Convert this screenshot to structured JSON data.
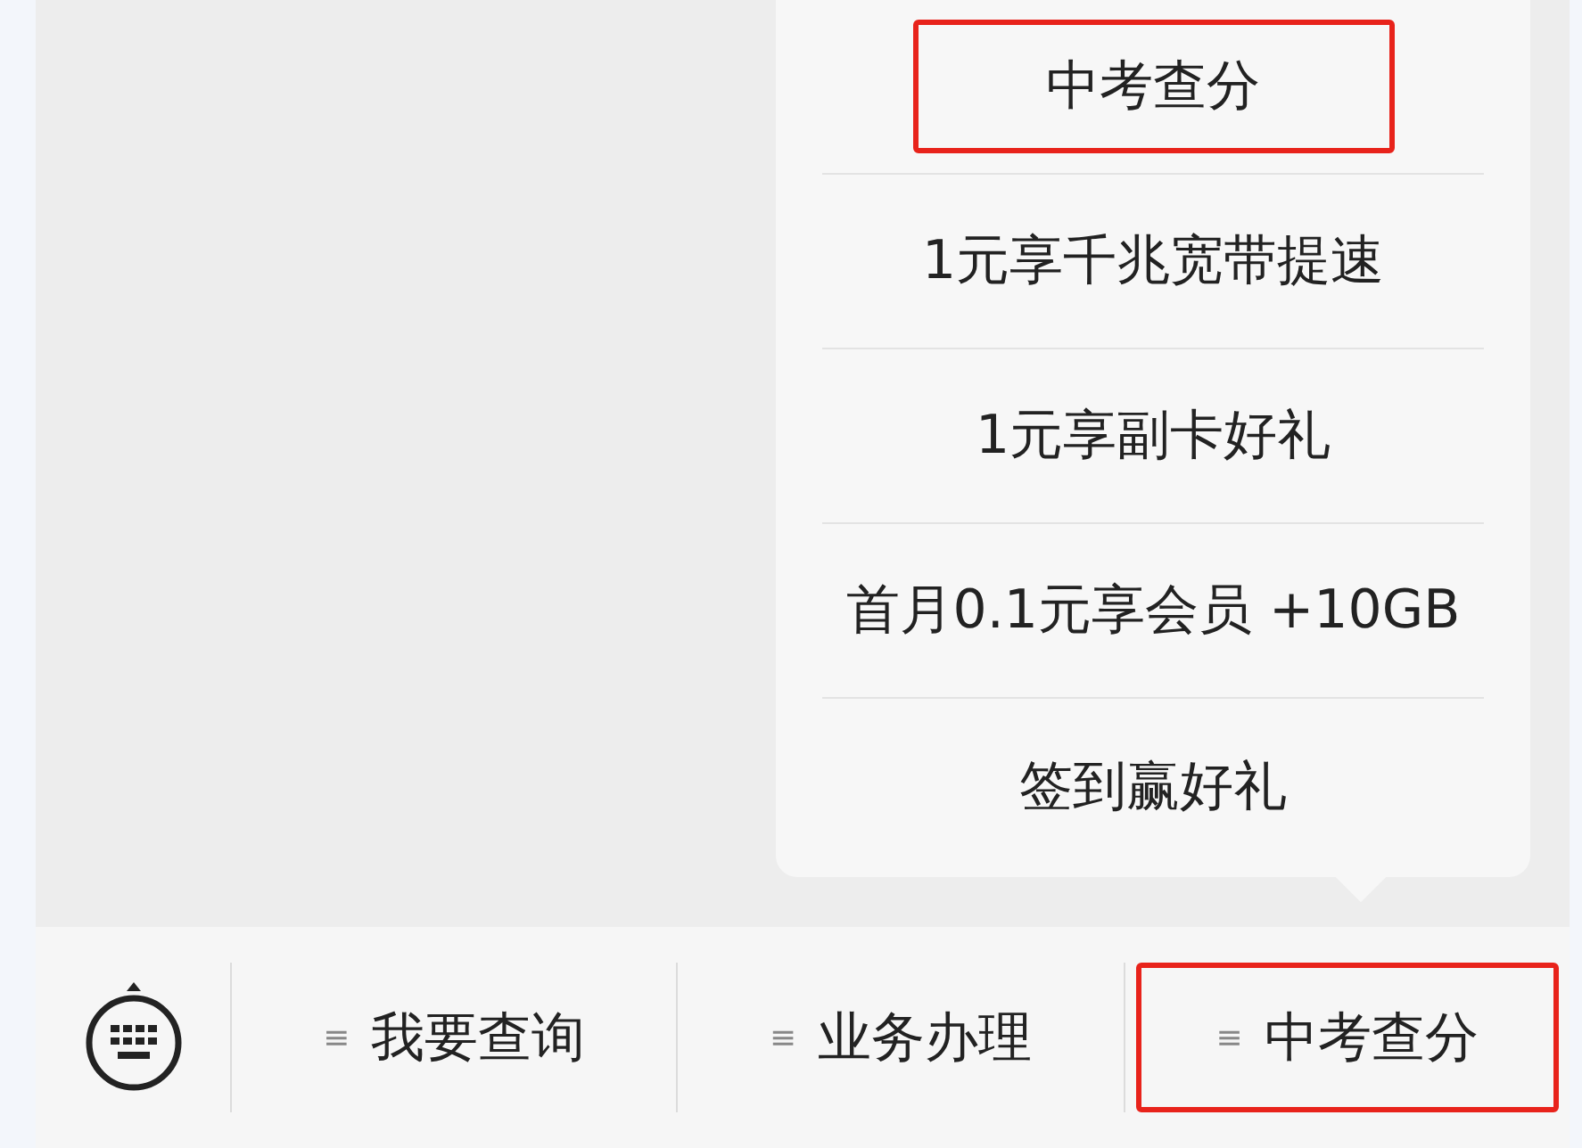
{
  "menu_popup": {
    "items": [
      {
        "label": "中考查分",
        "highlighted": true
      },
      {
        "label": "1元享千兆宽带提速",
        "highlighted": false
      },
      {
        "label": "1元享副卡好礼",
        "highlighted": false
      },
      {
        "label": "首月0.1元享会员 +10GB",
        "highlighted": false
      },
      {
        "label": "签到赢好礼",
        "highlighted": false
      }
    ]
  },
  "bottom_bar": {
    "buttons": [
      {
        "mark": "≡",
        "label": "我要查询",
        "highlighted": false
      },
      {
        "mark": "≡",
        "label": "业务办理",
        "highlighted": false
      },
      {
        "mark": "≡",
        "label": "中考查分",
        "highlighted": true
      }
    ]
  }
}
